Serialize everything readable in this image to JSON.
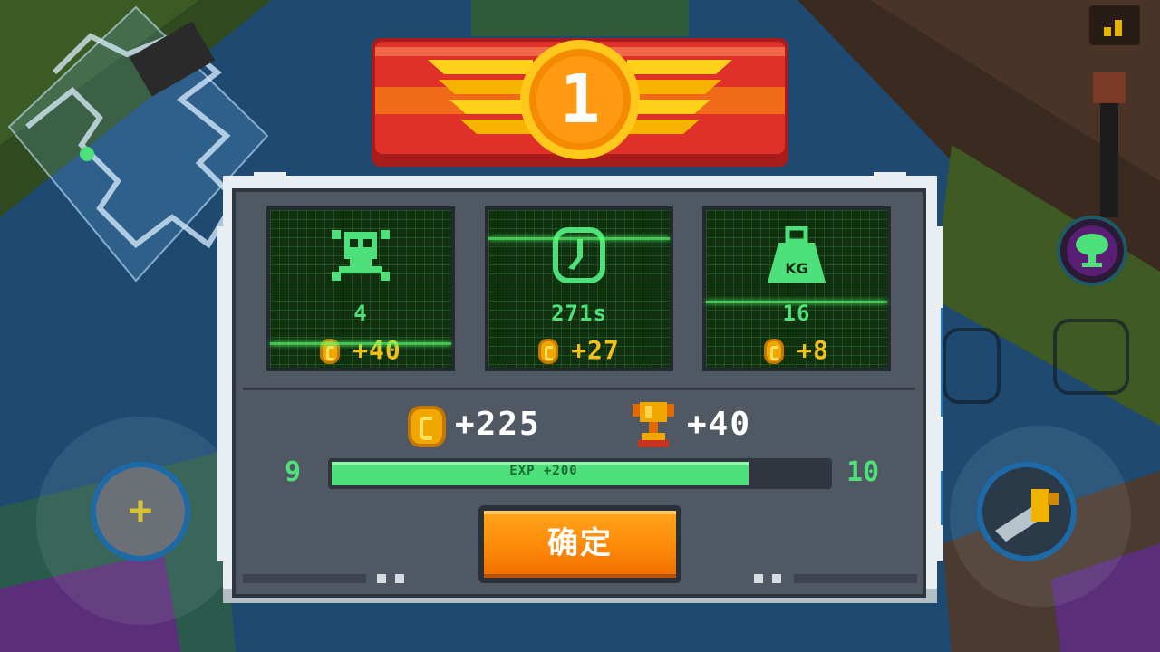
{
  "rank": "1",
  "stats": [
    {
      "icon": "skull-crossbones-icon",
      "value": "4",
      "reward": "+40"
    },
    {
      "icon": "clock-icon",
      "value": "271s",
      "reward": "+27"
    },
    {
      "icon": "weight-icon",
      "value": "16",
      "reward": "+8",
      "icon_label": "KG"
    }
  ],
  "totals": {
    "coins": "+225",
    "trophies": "+40"
  },
  "experience": {
    "current_level": "9",
    "next_level": "10",
    "label": "EXP +200",
    "progress": 0.84
  },
  "confirm_label": "确定",
  "colors": {
    "screen_green": "#4ee07a",
    "coin_gold": "#f3c21a",
    "button_orange": "#ff8c0a",
    "banner_red": "#e0302a"
  }
}
